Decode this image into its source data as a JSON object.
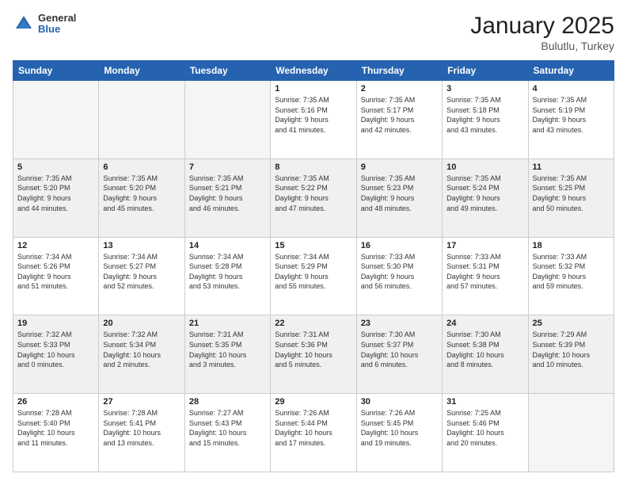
{
  "logo": {
    "general": "General",
    "blue": "Blue"
  },
  "header": {
    "month": "January 2025",
    "location": "Bulutlu, Turkey"
  },
  "weekdays": [
    "Sunday",
    "Monday",
    "Tuesday",
    "Wednesday",
    "Thursday",
    "Friday",
    "Saturday"
  ],
  "weeks": [
    [
      {
        "day": "",
        "text": "",
        "empty": true
      },
      {
        "day": "",
        "text": "",
        "empty": true
      },
      {
        "day": "",
        "text": "",
        "empty": true
      },
      {
        "day": "1",
        "text": "Sunrise: 7:35 AM\nSunset: 5:16 PM\nDaylight: 9 hours\nand 41 minutes."
      },
      {
        "day": "2",
        "text": "Sunrise: 7:35 AM\nSunset: 5:17 PM\nDaylight: 9 hours\nand 42 minutes."
      },
      {
        "day": "3",
        "text": "Sunrise: 7:35 AM\nSunset: 5:18 PM\nDaylight: 9 hours\nand 43 minutes."
      },
      {
        "day": "4",
        "text": "Sunrise: 7:35 AM\nSunset: 5:19 PM\nDaylight: 9 hours\nand 43 minutes."
      }
    ],
    [
      {
        "day": "5",
        "text": "Sunrise: 7:35 AM\nSunset: 5:20 PM\nDaylight: 9 hours\nand 44 minutes."
      },
      {
        "day": "6",
        "text": "Sunrise: 7:35 AM\nSunset: 5:20 PM\nDaylight: 9 hours\nand 45 minutes."
      },
      {
        "day": "7",
        "text": "Sunrise: 7:35 AM\nSunset: 5:21 PM\nDaylight: 9 hours\nand 46 minutes."
      },
      {
        "day": "8",
        "text": "Sunrise: 7:35 AM\nSunset: 5:22 PM\nDaylight: 9 hours\nand 47 minutes."
      },
      {
        "day": "9",
        "text": "Sunrise: 7:35 AM\nSunset: 5:23 PM\nDaylight: 9 hours\nand 48 minutes."
      },
      {
        "day": "10",
        "text": "Sunrise: 7:35 AM\nSunset: 5:24 PM\nDaylight: 9 hours\nand 49 minutes."
      },
      {
        "day": "11",
        "text": "Sunrise: 7:35 AM\nSunset: 5:25 PM\nDaylight: 9 hours\nand 50 minutes."
      }
    ],
    [
      {
        "day": "12",
        "text": "Sunrise: 7:34 AM\nSunset: 5:26 PM\nDaylight: 9 hours\nand 51 minutes."
      },
      {
        "day": "13",
        "text": "Sunrise: 7:34 AM\nSunset: 5:27 PM\nDaylight: 9 hours\nand 52 minutes."
      },
      {
        "day": "14",
        "text": "Sunrise: 7:34 AM\nSunset: 5:28 PM\nDaylight: 9 hours\nand 53 minutes."
      },
      {
        "day": "15",
        "text": "Sunrise: 7:34 AM\nSunset: 5:29 PM\nDaylight: 9 hours\nand 55 minutes."
      },
      {
        "day": "16",
        "text": "Sunrise: 7:33 AM\nSunset: 5:30 PM\nDaylight: 9 hours\nand 56 minutes."
      },
      {
        "day": "17",
        "text": "Sunrise: 7:33 AM\nSunset: 5:31 PM\nDaylight: 9 hours\nand 57 minutes."
      },
      {
        "day": "18",
        "text": "Sunrise: 7:33 AM\nSunset: 5:32 PM\nDaylight: 9 hours\nand 59 minutes."
      }
    ],
    [
      {
        "day": "19",
        "text": "Sunrise: 7:32 AM\nSunset: 5:33 PM\nDaylight: 10 hours\nand 0 minutes."
      },
      {
        "day": "20",
        "text": "Sunrise: 7:32 AM\nSunset: 5:34 PM\nDaylight: 10 hours\nand 2 minutes."
      },
      {
        "day": "21",
        "text": "Sunrise: 7:31 AM\nSunset: 5:35 PM\nDaylight: 10 hours\nand 3 minutes."
      },
      {
        "day": "22",
        "text": "Sunrise: 7:31 AM\nSunset: 5:36 PM\nDaylight: 10 hours\nand 5 minutes."
      },
      {
        "day": "23",
        "text": "Sunrise: 7:30 AM\nSunset: 5:37 PM\nDaylight: 10 hours\nand 6 minutes."
      },
      {
        "day": "24",
        "text": "Sunrise: 7:30 AM\nSunset: 5:38 PM\nDaylight: 10 hours\nand 8 minutes."
      },
      {
        "day": "25",
        "text": "Sunrise: 7:29 AM\nSunset: 5:39 PM\nDaylight: 10 hours\nand 10 minutes."
      }
    ],
    [
      {
        "day": "26",
        "text": "Sunrise: 7:28 AM\nSunset: 5:40 PM\nDaylight: 10 hours\nand 11 minutes."
      },
      {
        "day": "27",
        "text": "Sunrise: 7:28 AM\nSunset: 5:41 PM\nDaylight: 10 hours\nand 13 minutes."
      },
      {
        "day": "28",
        "text": "Sunrise: 7:27 AM\nSunset: 5:43 PM\nDaylight: 10 hours\nand 15 minutes."
      },
      {
        "day": "29",
        "text": "Sunrise: 7:26 AM\nSunset: 5:44 PM\nDaylight: 10 hours\nand 17 minutes."
      },
      {
        "day": "30",
        "text": "Sunrise: 7:26 AM\nSunset: 5:45 PM\nDaylight: 10 hours\nand 19 minutes."
      },
      {
        "day": "31",
        "text": "Sunrise: 7:25 AM\nSunset: 5:46 PM\nDaylight: 10 hours\nand 20 minutes."
      },
      {
        "day": "",
        "text": "",
        "empty": true
      }
    ]
  ]
}
